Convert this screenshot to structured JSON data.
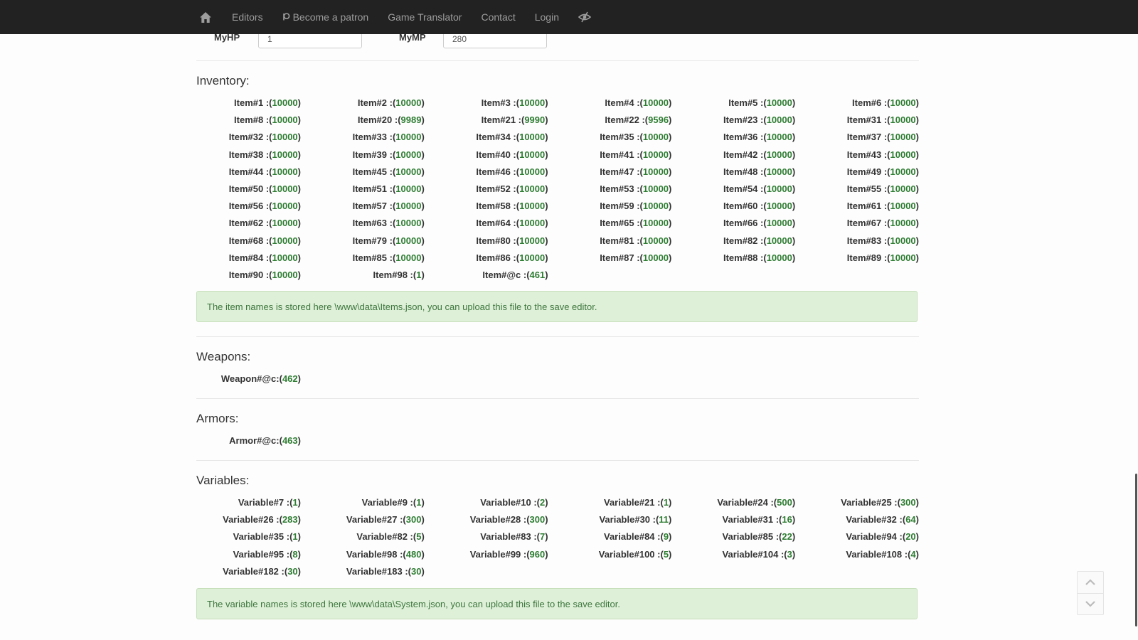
{
  "nav": {
    "items": [
      "Editors",
      "Become a patron",
      "Game Translator",
      "Contact",
      "Login"
    ]
  },
  "stats": {
    "hp_label": "MyHP",
    "hp_value": "1",
    "mp_label": "MyMP",
    "mp_value": "280"
  },
  "inventory": {
    "title": "Inventory:",
    "items": [
      [
        "Item#1 :(",
        "10000"
      ],
      [
        "Item#2 :(",
        "10000"
      ],
      [
        "Item#3 :(",
        "10000"
      ],
      [
        "Item#4 :(",
        "10000"
      ],
      [
        "Item#5 :(",
        "10000"
      ],
      [
        "Item#6 :(",
        "10000"
      ],
      [
        "Item#8 :(",
        "10000"
      ],
      [
        "Item#20 :(",
        "9989"
      ],
      [
        "Item#21 :(",
        "9990"
      ],
      [
        "Item#22 :(",
        "9596"
      ],
      [
        "Item#23 :(",
        "10000"
      ],
      [
        "Item#31 :(",
        "10000"
      ],
      [
        "Item#32 :(",
        "10000"
      ],
      [
        "Item#33 :(",
        "10000"
      ],
      [
        "Item#34 :(",
        "10000"
      ],
      [
        "Item#35 :(",
        "10000"
      ],
      [
        "Item#36 :(",
        "10000"
      ],
      [
        "Item#37 :(",
        "10000"
      ],
      [
        "Item#38 :(",
        "10000"
      ],
      [
        "Item#39 :(",
        "10000"
      ],
      [
        "Item#40 :(",
        "10000"
      ],
      [
        "Item#41 :(",
        "10000"
      ],
      [
        "Item#42 :(",
        "10000"
      ],
      [
        "Item#43 :(",
        "10000"
      ],
      [
        "Item#44 :(",
        "10000"
      ],
      [
        "Item#45 :(",
        "10000"
      ],
      [
        "Item#46 :(",
        "10000"
      ],
      [
        "Item#47 :(",
        "10000"
      ],
      [
        "Item#48 :(",
        "10000"
      ],
      [
        "Item#49 :(",
        "10000"
      ],
      [
        "Item#50 :(",
        "10000"
      ],
      [
        "Item#51 :(",
        "10000"
      ],
      [
        "Item#52 :(",
        "10000"
      ],
      [
        "Item#53 :(",
        "10000"
      ],
      [
        "Item#54 :(",
        "10000"
      ],
      [
        "Item#55 :(",
        "10000"
      ],
      [
        "Item#56 :(",
        "10000"
      ],
      [
        "Item#57 :(",
        "10000"
      ],
      [
        "Item#58 :(",
        "10000"
      ],
      [
        "Item#59 :(",
        "10000"
      ],
      [
        "Item#60 :(",
        "10000"
      ],
      [
        "Item#61 :(",
        "10000"
      ],
      [
        "Item#62 :(",
        "10000"
      ],
      [
        "Item#63 :(",
        "10000"
      ],
      [
        "Item#64 :(",
        "10000"
      ],
      [
        "Item#65 :(",
        "10000"
      ],
      [
        "Item#66 :(",
        "10000"
      ],
      [
        "Item#67 :(",
        "10000"
      ],
      [
        "Item#68 :(",
        "10000"
      ],
      [
        "Item#79 :(",
        "10000"
      ],
      [
        "Item#80 :(",
        "10000"
      ],
      [
        "Item#81 :(",
        "10000"
      ],
      [
        "Item#82 :(",
        "10000"
      ],
      [
        "Item#83 :(",
        "10000"
      ],
      [
        "Item#84 :(",
        "10000"
      ],
      [
        "Item#85 :(",
        "10000"
      ],
      [
        "Item#86 :(",
        "10000"
      ],
      [
        "Item#87 :(",
        "10000"
      ],
      [
        "Item#88 :(",
        "10000"
      ],
      [
        "Item#89 :(",
        "10000"
      ],
      [
        "Item#90 :(",
        "10000"
      ],
      [
        "Item#98 :(",
        "1"
      ],
      [
        "Item#@c :(",
        "461"
      ]
    ],
    "note": "The item names is stored here \\www\\data\\Items.json, you can upload this file to the save editor."
  },
  "weapons": {
    "title": "Weapons:",
    "items": [
      [
        "Weapon#@c:(",
        "462"
      ]
    ]
  },
  "armors": {
    "title": "Armors:",
    "items": [
      [
        "Armor#@c:(",
        "463"
      ]
    ]
  },
  "variables": {
    "title": "Variables:",
    "items": [
      [
        "Variable#7 :(",
        "1"
      ],
      [
        "Variable#9 :(",
        "1"
      ],
      [
        "Variable#10 :(",
        "2"
      ],
      [
        "Variable#21 :(",
        "1"
      ],
      [
        "Variable#24 :(",
        "500"
      ],
      [
        "Variable#25 :(",
        "300"
      ],
      [
        "Variable#26 :(",
        "283"
      ],
      [
        "Variable#27 :(",
        "300"
      ],
      [
        "Variable#28 :(",
        "300"
      ],
      [
        "Variable#30 :(",
        "11"
      ],
      [
        "Variable#31 :(",
        "16"
      ],
      [
        "Variable#32 :(",
        "64"
      ],
      [
        "Variable#35 :(",
        "1"
      ],
      [
        "Variable#82 :(",
        "5"
      ],
      [
        "Variable#83 :(",
        "7"
      ],
      [
        "Variable#84 :(",
        "9"
      ],
      [
        "Variable#85 :(",
        "22"
      ],
      [
        "Variable#94 :(",
        "20"
      ],
      [
        "Variable#95 :(",
        "8"
      ],
      [
        "Variable#98 :(",
        "480"
      ],
      [
        "Variable#99 :(",
        "960"
      ],
      [
        "Variable#100 :(",
        "5"
      ],
      [
        "Variable#104 :(",
        "3"
      ],
      [
        "Variable#108 :(",
        "4"
      ],
      [
        "Variable#182 :(",
        "30"
      ],
      [
        "Variable#183 :(",
        "30"
      ]
    ],
    "note": "The variable names is stored here \\www\\data\\System.json, you can upload this file to the save editor."
  },
  "colors": {
    "navbar": "#222222",
    "value_green": "#2e7d32",
    "alert_bg": "#dff0d8",
    "alert_text": "#3c763d"
  }
}
